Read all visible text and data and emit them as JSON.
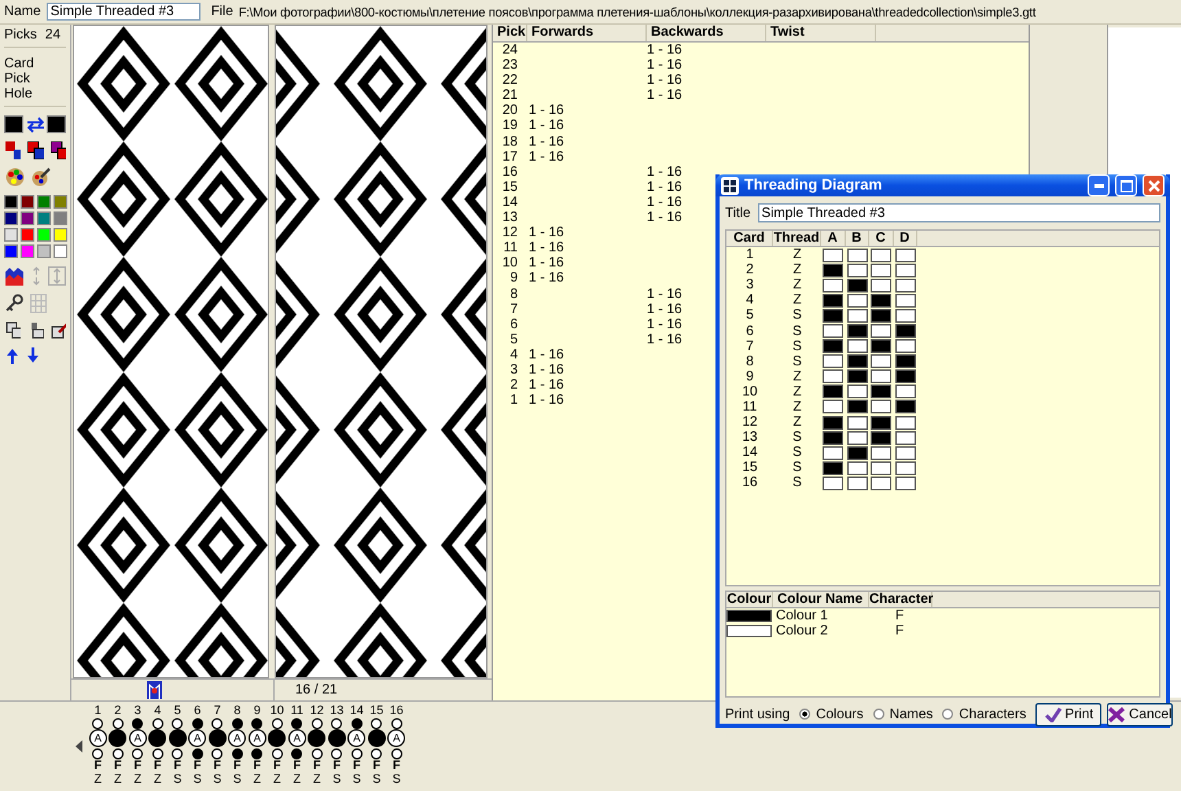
{
  "header": {
    "name_label": "Name",
    "name_value": "Simple Threaded #3",
    "file_label": "File",
    "file_path": "F:\\Мои фотографии\\800-костюмы\\плетение поясов\\программа плетения-шаблоны\\коллекция-разархивирована\\threadedcollection\\simple3.gtt"
  },
  "sidebar": {
    "picks_label": "Picks",
    "picks_value": "24",
    "items": [
      {
        "label": "Card"
      },
      {
        "label": "Pick"
      },
      {
        "label": "Hole"
      }
    ],
    "current_colors": [
      {
        "color": "#000000"
      },
      {
        "color": "#000000"
      }
    ],
    "palette": [
      {
        "color": "#000000"
      },
      {
        "color": "#800000"
      },
      {
        "color": "#008000"
      },
      {
        "color": "#808000"
      },
      {
        "color": "#000080"
      },
      {
        "color": "#800080"
      },
      {
        "color": "#008080"
      },
      {
        "color": "#808080"
      },
      {
        "color": "#e0e0e0"
      },
      {
        "color": "#ff0000"
      },
      {
        "color": "#00ff00"
      },
      {
        "color": "#ffff00"
      },
      {
        "color": "#0000ff"
      },
      {
        "color": "#ff00ff"
      },
      {
        "color": "#c0c0c0"
      },
      {
        "color": "#ffffff"
      }
    ]
  },
  "status": {
    "position": "16 / 21"
  },
  "pick_table": {
    "columns": [
      "Pick",
      "Forwards",
      "Backwards",
      "Twist"
    ],
    "rows": [
      {
        "pick": "24",
        "forwards": "",
        "backwards": "1 - 16"
      },
      {
        "pick": "23",
        "forwards": "",
        "backwards": "1 - 16"
      },
      {
        "pick": "22",
        "forwards": "",
        "backwards": "1 - 16"
      },
      {
        "pick": "21",
        "forwards": "",
        "backwards": "1 - 16"
      },
      {
        "pick": "20",
        "forwards": "1 - 16",
        "backwards": ""
      },
      {
        "pick": "19",
        "forwards": "1 - 16",
        "backwards": ""
      },
      {
        "pick": "18",
        "forwards": "1 - 16",
        "backwards": ""
      },
      {
        "pick": "17",
        "forwards": "1 - 16",
        "backwards": ""
      },
      {
        "pick": "16",
        "forwards": "",
        "backwards": "1 - 16"
      },
      {
        "pick": "15",
        "forwards": "",
        "backwards": "1 - 16"
      },
      {
        "pick": "14",
        "forwards": "",
        "backwards": "1 - 16"
      },
      {
        "pick": "13",
        "forwards": "",
        "backwards": "1 - 16"
      },
      {
        "pick": "12",
        "forwards": "1 - 16",
        "backwards": ""
      },
      {
        "pick": "11",
        "forwards": "1 - 16",
        "backwards": ""
      },
      {
        "pick": "10",
        "forwards": "1 - 16",
        "backwards": ""
      },
      {
        "pick": "9",
        "forwards": "1 - 16",
        "backwards": ""
      },
      {
        "pick": "8",
        "forwards": "",
        "backwards": "1 - 16"
      },
      {
        "pick": "7",
        "forwards": "",
        "backwards": "1 - 16"
      },
      {
        "pick": "6",
        "forwards": "",
        "backwards": "1 - 16"
      },
      {
        "pick": "5",
        "forwards": "",
        "backwards": "1 - 16"
      },
      {
        "pick": "4",
        "forwards": "1 - 16",
        "backwards": ""
      },
      {
        "pick": "3",
        "forwards": "1 - 16",
        "backwards": ""
      },
      {
        "pick": "2",
        "forwards": "1 - 16",
        "backwards": ""
      },
      {
        "pick": "1",
        "forwards": "1 - 16",
        "backwards": ""
      }
    ]
  },
  "cards": [
    {
      "number": "1",
      "top_filled": false,
      "center_filled": false,
      "center_label": "A",
      "bottom_filled": false,
      "face": "F",
      "direction": "Z"
    },
    {
      "number": "2",
      "top_filled": false,
      "center_filled": true,
      "bottom_filled": false,
      "face": "F",
      "direction": "Z"
    },
    {
      "number": "3",
      "top_filled": true,
      "center_filled": false,
      "center_label": "A",
      "bottom_filled": false,
      "face": "F",
      "direction": "Z"
    },
    {
      "number": "4",
      "top_filled": false,
      "center_filled": true,
      "bottom_filled": false,
      "face": "F",
      "direction": "Z"
    },
    {
      "number": "5",
      "top_filled": false,
      "center_filled": true,
      "bottom_filled": false,
      "face": "F",
      "direction": "S"
    },
    {
      "number": "6",
      "top_filled": true,
      "center_filled": false,
      "center_label": "A",
      "bottom_filled": true,
      "face": "F",
      "direction": "S"
    },
    {
      "number": "7",
      "top_filled": false,
      "center_filled": true,
      "bottom_filled": false,
      "face": "F",
      "direction": "S"
    },
    {
      "number": "8",
      "top_filled": true,
      "center_filled": false,
      "center_label": "A",
      "bottom_filled": true,
      "face": "F",
      "direction": "S"
    },
    {
      "number": "9",
      "top_filled": true,
      "center_filled": false,
      "center_label": "A",
      "bottom_filled": true,
      "face": "F",
      "direction": "Z"
    },
    {
      "number": "10",
      "top_filled": false,
      "center_filled": true,
      "bottom_filled": false,
      "face": "F",
      "direction": "Z"
    },
    {
      "number": "11",
      "top_filled": true,
      "center_filled": false,
      "center_label": "A",
      "bottom_filled": true,
      "face": "F",
      "direction": "Z"
    },
    {
      "number": "12",
      "top_filled": false,
      "center_filled": true,
      "bottom_filled": false,
      "face": "F",
      "direction": "Z"
    },
    {
      "number": "13",
      "top_filled": false,
      "center_filled": true,
      "bottom_filled": false,
      "face": "F",
      "direction": "S"
    },
    {
      "number": "14",
      "top_filled": true,
      "center_filled": false,
      "center_label": "A",
      "bottom_filled": false,
      "face": "F",
      "direction": "S"
    },
    {
      "number": "15",
      "top_filled": false,
      "center_filled": true,
      "bottom_filled": false,
      "face": "F",
      "direction": "S"
    },
    {
      "number": "16",
      "top_filled": false,
      "center_filled": false,
      "center_label": "A",
      "bottom_filled": false,
      "face": "F",
      "direction": "S"
    }
  ],
  "dialog": {
    "title": "Threading Diagram",
    "title_label": "Title",
    "title_value": "Simple Threaded #3",
    "card_columns": [
      "Card",
      "Thread",
      "A",
      "B",
      "C",
      "D"
    ],
    "card_rows": [
      {
        "card": "1",
        "thread": "Z",
        "holes": [
          false,
          false,
          false,
          false
        ]
      },
      {
        "card": "2",
        "thread": "Z",
        "holes": [
          true,
          false,
          false,
          false
        ]
      },
      {
        "card": "3",
        "thread": "Z",
        "holes": [
          false,
          true,
          false,
          false
        ]
      },
      {
        "card": "4",
        "thread": "Z",
        "holes": [
          true,
          false,
          true,
          false
        ]
      },
      {
        "card": "5",
        "thread": "S",
        "holes": [
          true,
          false,
          true,
          false
        ]
      },
      {
        "card": "6",
        "thread": "S",
        "holes": [
          false,
          true,
          false,
          true
        ]
      },
      {
        "card": "7",
        "thread": "S",
        "holes": [
          true,
          false,
          true,
          false
        ]
      },
      {
        "card": "8",
        "thread": "S",
        "holes": [
          false,
          true,
          false,
          true
        ]
      },
      {
        "card": "9",
        "thread": "Z",
        "holes": [
          false,
          true,
          false,
          true
        ]
      },
      {
        "card": "10",
        "thread": "Z",
        "holes": [
          true,
          false,
          true,
          false
        ]
      },
      {
        "card": "11",
        "thread": "Z",
        "holes": [
          false,
          true,
          false,
          true
        ]
      },
      {
        "card": "12",
        "thread": "Z",
        "holes": [
          true,
          false,
          true,
          false
        ]
      },
      {
        "card": "13",
        "thread": "S",
        "holes": [
          true,
          false,
          true,
          false
        ]
      },
      {
        "card": "14",
        "thread": "S",
        "holes": [
          false,
          true,
          false,
          false
        ]
      },
      {
        "card": "15",
        "thread": "S",
        "holes": [
          true,
          false,
          false,
          false
        ]
      },
      {
        "card": "16",
        "thread": "S",
        "holes": [
          false,
          false,
          false,
          false
        ]
      }
    ],
    "colour_columns": [
      "Colour",
      "Colour Name",
      "Character"
    ],
    "colour_rows": [
      {
        "color": "#000000",
        "name": "Colour 1",
        "character": "F"
      },
      {
        "color": "#ffffff",
        "name": "Colour 2",
        "character": "F"
      }
    ],
    "print_label": "Print using",
    "print_options": [
      {
        "label": "Colours",
        "selected": true
      },
      {
        "label": "Names",
        "selected": false
      },
      {
        "label": "Characters",
        "selected": false
      }
    ],
    "buttons": [
      {
        "kind": "print",
        "label": "Print"
      },
      {
        "kind": "cancel",
        "label": "Cancel"
      }
    ]
  }
}
